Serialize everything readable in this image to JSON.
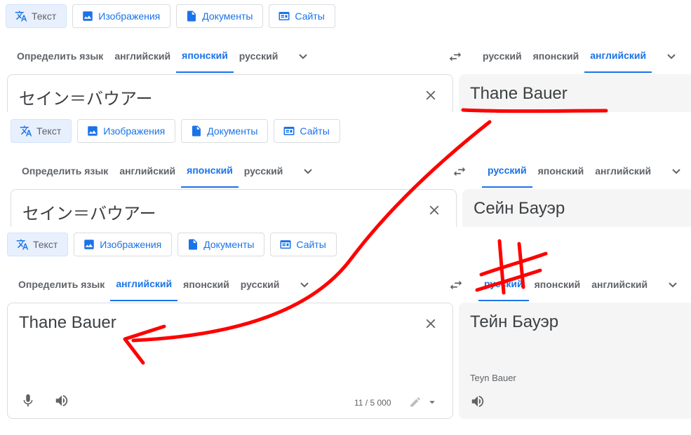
{
  "modes": {
    "text": "Текст",
    "images": "Изображения",
    "documents": "Документы",
    "sites": "Сайты"
  },
  "source_langs": [
    "Определить язык",
    "английский",
    "японский",
    "русский"
  ],
  "panels": [
    {
      "source_active_index": 2,
      "target_langs": [
        "русский",
        "японский",
        "английский"
      ],
      "target_active_index": 2,
      "source_text": "セイン＝バウアー",
      "target_text": "Thane Bauer"
    },
    {
      "source_active_index": 2,
      "target_langs": [
        "русский",
        "японский",
        "английский"
      ],
      "target_active_index": 0,
      "source_text": "セイン＝バウアー",
      "target_text": "Сейн Бауэр"
    },
    {
      "source_active_index": 1,
      "target_langs": [
        "русский",
        "японский",
        "английский"
      ],
      "target_active_index": 0,
      "source_text": "Thane Bauer",
      "target_text": "Тейн Бауэр",
      "transliteration": "Teyn Bauer",
      "char_count": "11 / 5 000"
    }
  ],
  "icons": {
    "translate": "translate-icon",
    "image": "image-icon",
    "document": "document-icon",
    "website": "website-icon",
    "swap": "swap-arrows-icon",
    "close": "close-icon",
    "chevron": "chevron-down-icon",
    "mic": "microphone-icon",
    "speaker": "speaker-icon",
    "pencil": "pencil-icon"
  },
  "colors": {
    "accent": "#1a73e8",
    "text": "#3c4043",
    "muted": "#5f6368",
    "target_bg": "#f5f5f5",
    "annotation": "#ff0000"
  }
}
